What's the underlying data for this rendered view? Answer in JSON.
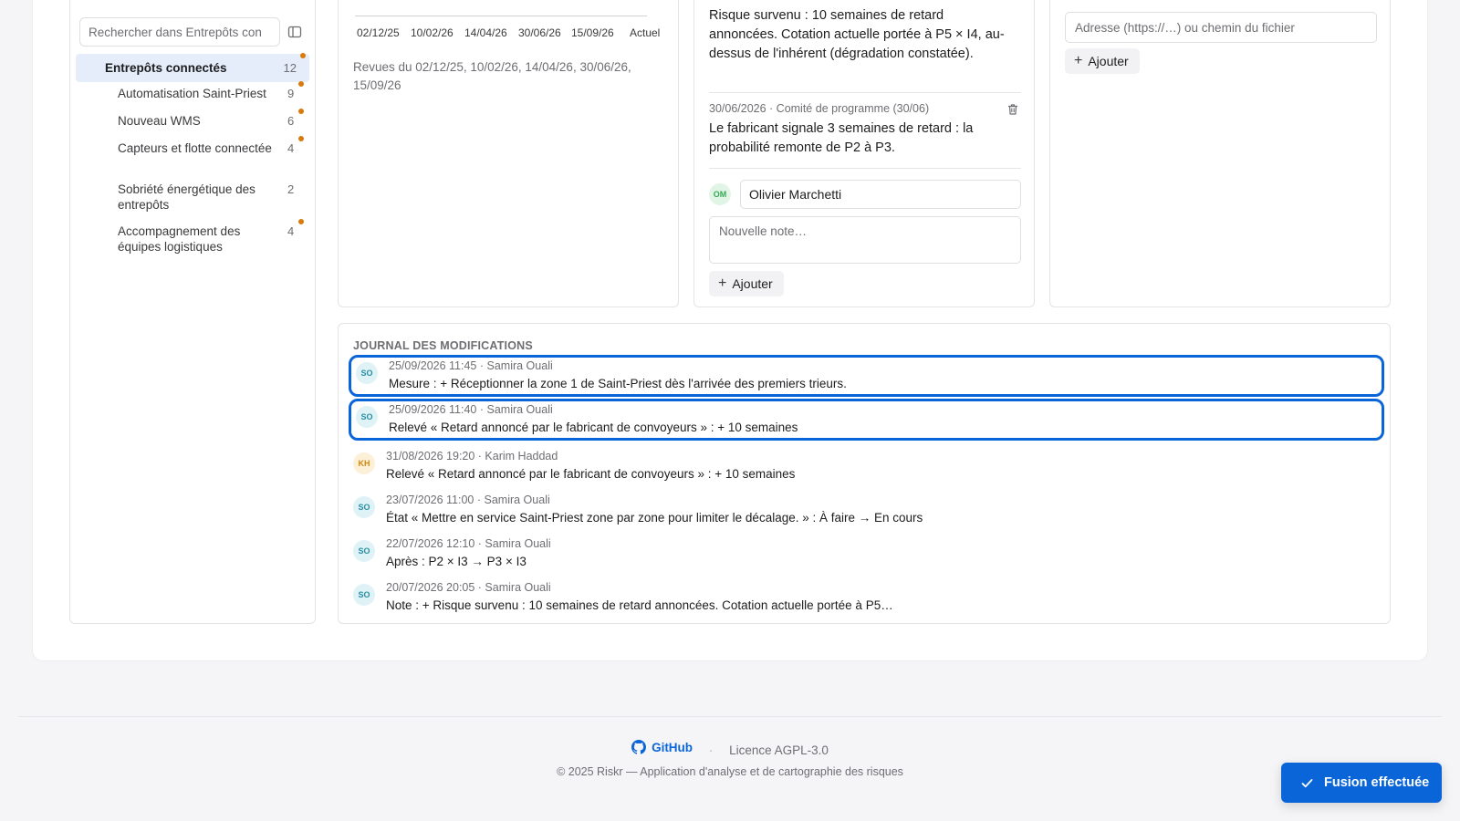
{
  "sidebar": {
    "search_placeholder": "Rechercher dans Entrepôts con",
    "root": {
      "label": "Entrepôts connectés",
      "count": "12"
    },
    "items": [
      {
        "label": "Automatisation Saint-Priest",
        "count": "9"
      },
      {
        "label": "Nouveau WMS",
        "count": "6"
      },
      {
        "label": "Capteurs et flotte connectée",
        "count": "4"
      },
      {
        "label": "Sobriété énergétique des entrepôts",
        "count": "2"
      },
      {
        "label": "Accompagnement des équipes logistiques",
        "count": "4"
      }
    ]
  },
  "timeline": {
    "ticks": [
      "02/12/25",
      "10/02/26",
      "14/04/26",
      "30/06/26",
      "15/09/26",
      "Actuel"
    ],
    "caption": "Revues du 02/12/25, 10/02/26, 14/04/26, 30/06/26, 15/09/26"
  },
  "notes": {
    "first_text": "Risque survenu : 10 semaines de retard annoncées. Cotation actuelle portée à P5 × I4, au-dessus de l'inhérent (dégradation constatée).",
    "second_meta": "30/06/2026 · Comité de programme (30/06)",
    "second_text": "Le fabricant signale 3 semaines de retard : la probabilité remonte de P2 à P3.",
    "author_initials": "OM",
    "author_value": "Olivier Marchetti",
    "new_note_placeholder": "Nouvelle note…",
    "add_label": "Ajouter"
  },
  "links": {
    "url_placeholder": "Adresse (https://…) ou chemin du fichier",
    "add_label": "Ajouter"
  },
  "journal": {
    "title": "JOURNAL DES MODIFICATIONS",
    "entries": [
      {
        "initials": "SO",
        "meta": "25/09/2026 11:45 · Samira Ouali",
        "msg": "Mesure : + Réceptionner la zone 1 de Saint-Priest dès l'arrivée des premiers trieurs."
      },
      {
        "initials": "SO",
        "meta": "25/09/2026 11:40 · Samira Ouali",
        "msg": "Relevé « Retard annoncé par le fabricant de convoyeurs » : + 10 semaines"
      },
      {
        "initials": "KH",
        "meta": "31/08/2026 19:20 · Karim Haddad",
        "msg": "Relevé « Retard annoncé par le fabricant de convoyeurs » : + 10 semaines"
      },
      {
        "initials": "SO",
        "meta": "23/07/2026 11:00 · Samira Ouali",
        "msg": "État « Mettre en service Saint-Priest zone par zone pour limiter le décalage. » : À faire → En cours"
      },
      {
        "initials": "SO",
        "meta": "22/07/2026 12:10 · Samira Ouali",
        "msg": "Après : P2 × I3 → P3 × I3"
      },
      {
        "initials": "SO",
        "meta": "20/07/2026 20:05 · Samira Ouali",
        "msg": "Note : + Risque survenu : 10 semaines de retard annoncées. Cotation actuelle portée à P5…"
      }
    ]
  },
  "footer": {
    "github": "GitHub",
    "bullet": "·",
    "licence": "Licence AGPL-3.0",
    "copyright": "© 2025 Riskr — Application d'analyse et de cartographie des risques"
  },
  "toast": {
    "label": "Fusion effectuée"
  },
  "colors": {
    "accent": "#0a66d8",
    "dot": "#d97a0b",
    "selected_row": "#e4edf9"
  }
}
